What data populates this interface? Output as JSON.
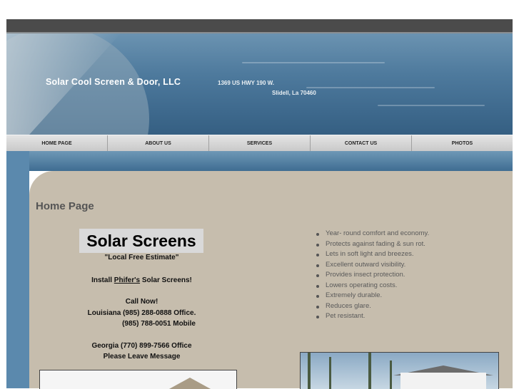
{
  "header": {
    "company_name": "Solar Cool Screen & Door, LLC",
    "address_line1": "1369 US HWY 190 W.",
    "address_line2": "Slidell, La 70460"
  },
  "nav": {
    "items": [
      "HOME PAGE",
      "ABOUT US",
      "SERVICES",
      "CONTACT US",
      "PHOTOS"
    ]
  },
  "main": {
    "page_title": "Home Page",
    "solar_title": "Solar Screens",
    "estimate": "\"Local Free Estimate\"",
    "install_prefix": "Install ",
    "install_brand": "Phifer's",
    "install_suffix": " Solar Screens!",
    "call_now": "Call Now!",
    "louisiana": "Louisiana (985) 288-0888 Office.",
    "mobile": "(985) 788-0051 Mobile",
    "georgia": "Georgia    (770) 899-7566 Office",
    "leave_message": "Please Leave Message",
    "features": [
      "Year- round comfort and economy.",
      "Protects against fading & sun rot.",
      "Lets in soft light and breezes.",
      "Excellent outward visibility.",
      "Provides insect protection.",
      "Lowers operating costs.",
      "Extremely durable.",
      "Reduces glare.",
      "Pet resistant."
    ]
  },
  "colors": {
    "header_blue": "#4e7a9d",
    "content_bg": "#c6bdad",
    "nav_bg": "#d6d6d6",
    "topbar": "#4b4b4b"
  }
}
